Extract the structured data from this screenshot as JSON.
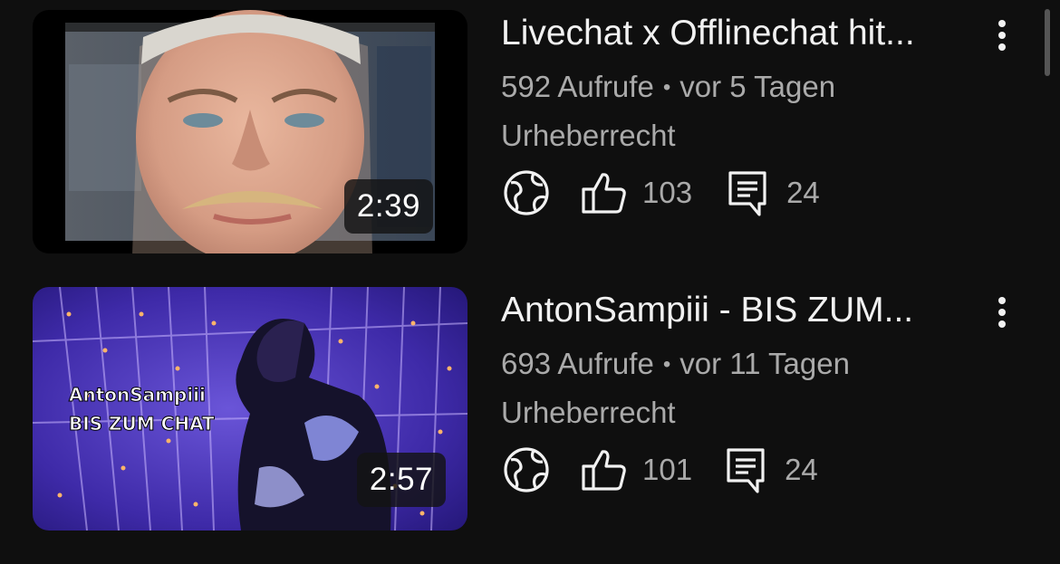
{
  "videos": [
    {
      "title": "Livechat x Offlinechat hit...",
      "duration": "2:39",
      "views": "592 Aufrufe",
      "age": "vor 5 Tagen",
      "visibility_note": "Urheberrecht",
      "likes": "103",
      "comments": "24"
    },
    {
      "title": "AntonSampiii - BIS ZUM...",
      "duration": "2:57",
      "views": "693 Aufrufe",
      "age": "vor 11 Tagen",
      "visibility_note": "Urheberrecht",
      "likes": "101",
      "comments": "24",
      "thumbnail_text_1": "AntonSampiii",
      "thumbnail_text_2": "BIS ZUM CHAT"
    }
  ],
  "separator": "•",
  "icons": {
    "visibility": "globe-icon",
    "likes": "thumbs-up-icon",
    "comments": "comment-icon",
    "menu": "more-vert-icon"
  },
  "colors": {
    "background": "#0f0f0f",
    "title_text": "#f1f1f1",
    "secondary_text": "#aaaaaa",
    "duration_badge": "#141414"
  }
}
